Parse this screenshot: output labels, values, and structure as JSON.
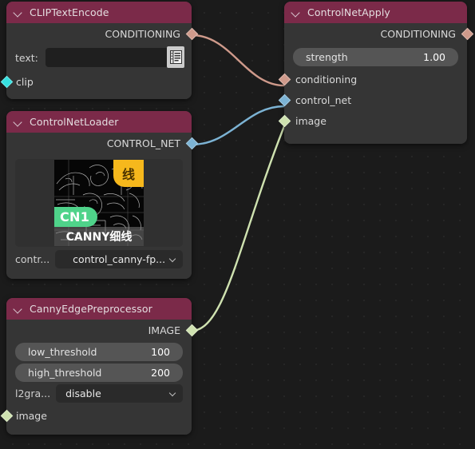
{
  "app": {
    "name": "node-graph-editor",
    "background_color": "#1b1b1b",
    "grid_dot_color": "#262626"
  },
  "palette": {
    "node_header": "#7b2a49",
    "node_body": "#353535",
    "widget": "#555555",
    "combo": "#2a2a2a",
    "conditioning": "#cf9a8b",
    "control_net": "#7cb3d4",
    "image": "#cfe2b0",
    "clip": "#36e0e0"
  },
  "nodes": [
    {
      "id": "clip-text-encode",
      "title": "CLIPTextEncode",
      "collapse_icon": "chevron-down-icon",
      "outputs": [
        {
          "label": "CONDITIONING",
          "type": "CONDITIONING",
          "color": "#cf9a8b"
        }
      ],
      "widgets": [
        {
          "kind": "text",
          "label": "text:",
          "value": "",
          "placeholder": "",
          "icon": "notepad-icon"
        }
      ],
      "inputs": [
        {
          "label": "clip",
          "type": "CLIP",
          "color": "#36e0e0"
        }
      ]
    },
    {
      "id": "control-net-loader",
      "title": "ControlNetLoader",
      "collapse_icon": "chevron-down-icon",
      "outputs": [
        {
          "label": "CONTROL_NET",
          "type": "CONTROL_NET",
          "color": "#7cb3d4"
        }
      ],
      "preview": {
        "badge_top_right": "线",
        "badge_bottom_left": "CN1",
        "caption": "CANNY细线",
        "alt": "canny edge preview thumbnail"
      },
      "widgets": [
        {
          "kind": "combo",
          "label": "contr...",
          "value": "control_canny-fp...",
          "icon": "chevron-down-icon"
        }
      ],
      "inputs": []
    },
    {
      "id": "canny-edge-preprocessor",
      "title": "CannyEdgePreprocessor",
      "collapse_icon": "chevron-down-icon",
      "outputs": [
        {
          "label": "IMAGE",
          "type": "IMAGE",
          "color": "#cfe2b0"
        }
      ],
      "widgets": [
        {
          "kind": "number",
          "label": "low_threshold",
          "value": "100"
        },
        {
          "kind": "number",
          "label": "high_threshold",
          "value": "200"
        },
        {
          "kind": "combo",
          "label": "l2gra...",
          "value": "disable",
          "icon": "chevron-down-icon"
        }
      ],
      "inputs": [
        {
          "label": "image",
          "type": "IMAGE",
          "color": "#cfe2b0"
        }
      ]
    },
    {
      "id": "control-net-apply",
      "title": "ControlNetApply",
      "collapse_icon": "chevron-down-icon",
      "outputs": [
        {
          "label": "CONDITIONING",
          "type": "CONDITIONING",
          "color": "#cf9a8b"
        }
      ],
      "widgets": [
        {
          "kind": "number",
          "label": "strength",
          "value": "1.00"
        }
      ],
      "inputs": [
        {
          "label": "conditioning",
          "type": "CONDITIONING",
          "color": "#cf9a8b"
        },
        {
          "label": "control_net",
          "type": "CONTROL_NET",
          "color": "#7cb3d4"
        },
        {
          "label": "image",
          "type": "IMAGE",
          "color": "#cfe2b0"
        }
      ]
    }
  ],
  "links": [
    {
      "from": "clip-text-encode.CONDITIONING",
      "to": "control-net-apply.conditioning",
      "color": "#cf9a8b"
    },
    {
      "from": "control-net-loader.CONTROL_NET",
      "to": "control-net-apply.control_net",
      "color": "#7cb3d4"
    },
    {
      "from": "canny-edge-preprocessor.IMAGE",
      "to": "control-net-apply.image",
      "color": "#cfe2b0"
    }
  ]
}
